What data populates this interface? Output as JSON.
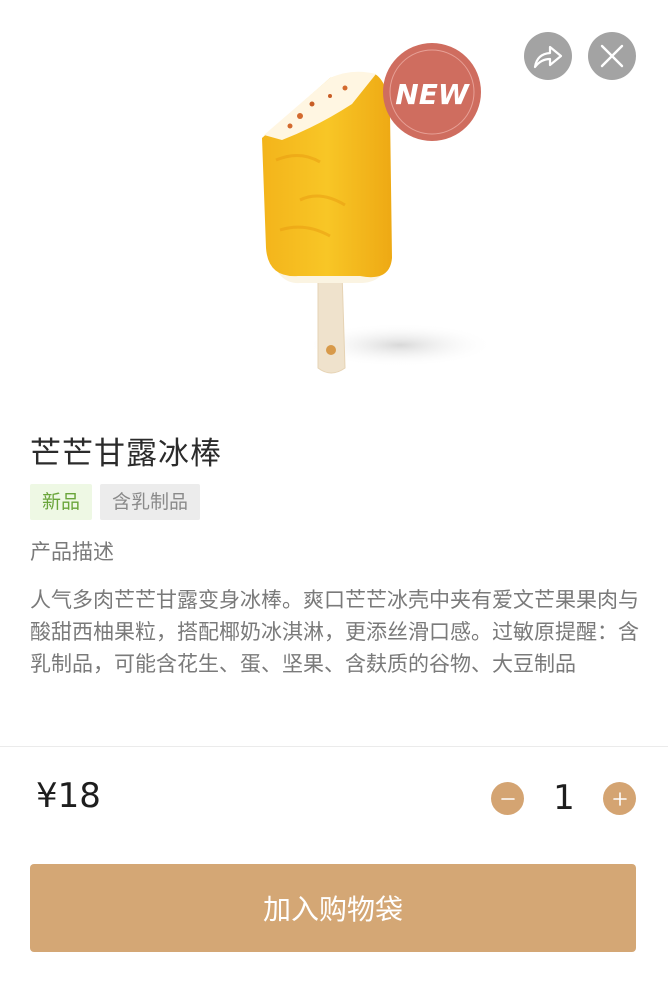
{
  "hero": {
    "badge_text": "NEW"
  },
  "product": {
    "title": "芒芒甘露冰棒",
    "tags": [
      "新品",
      "含乳制品"
    ],
    "description_heading": "产品描述",
    "description": "人气多肉芒芒甘露变身冰棒。爽口芒芒冰壳中夹有爱文芒果果肉与酸甜西柚果粒，搭配椰奶冰淇淋，更添丝滑口感。过敏原提醒：含乳制品，可能含花生、蛋、坚果、含麸质的谷物、大豆制品"
  },
  "purchase": {
    "price": "¥18",
    "quantity": "1",
    "add_to_bag_label": "加入购物袋"
  },
  "colors": {
    "accent": "#d4a775",
    "stepper": "#d4a472",
    "new_tag_bg": "#eef8e4",
    "new_tag_text": "#6aa53b",
    "badge_red": "#cf6d5f",
    "icon_button_gray": "#a3a3a3"
  },
  "icons": {
    "share": "share-arrow-icon",
    "close": "close-icon",
    "minus": "minus-icon",
    "plus": "plus-icon"
  }
}
